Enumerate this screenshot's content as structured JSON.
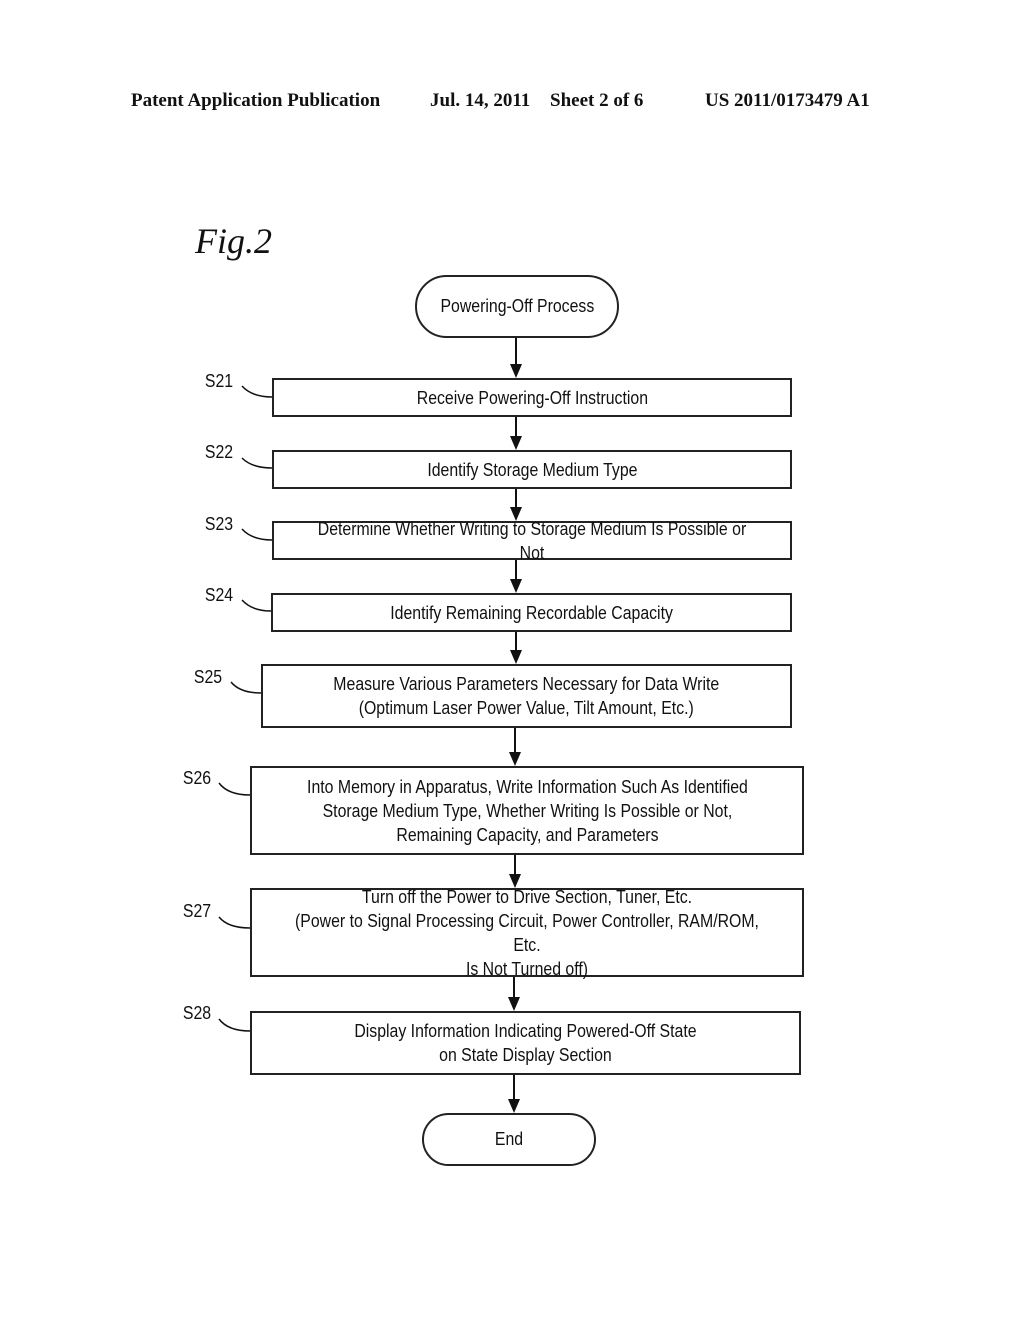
{
  "header": {
    "publication": "Patent Application Publication",
    "date": "Jul. 14, 2011",
    "sheet": "Sheet 2 of 6",
    "number": "US 2011/0173479 A1"
  },
  "figure_label": "Fig.2",
  "flowchart": {
    "start": "Powering-Off Process",
    "end": "End",
    "steps": [
      {
        "id": "S21",
        "text": "Receive Powering-Off Instruction"
      },
      {
        "id": "S22",
        "text": "Identify Storage Medium Type"
      },
      {
        "id": "S23",
        "text": "Determine Whether Writing to Storage Medium Is Possible or Not"
      },
      {
        "id": "S24",
        "text": "Identify Remaining Recordable Capacity"
      },
      {
        "id": "S25",
        "text": "Measure Various Parameters Necessary for Data Write\n(Optimum Laser Power Value, Tilt Amount, Etc.)"
      },
      {
        "id": "S26",
        "text": "Into Memory in Apparatus, Write Information Such As Identified\nStorage Medium Type, Whether Writing Is Possible or Not,\nRemaining Capacity, and Parameters"
      },
      {
        "id": "S27",
        "text": "Turn off the Power to Drive Section, Tuner, Etc.\n(Power to Signal Processing Circuit, Power Controller, RAM/ROM, Etc.\nIs Not Turned off)"
      },
      {
        "id": "S28",
        "text": "Display Information Indicating Powered-Off State\non State Display Section"
      }
    ]
  }
}
